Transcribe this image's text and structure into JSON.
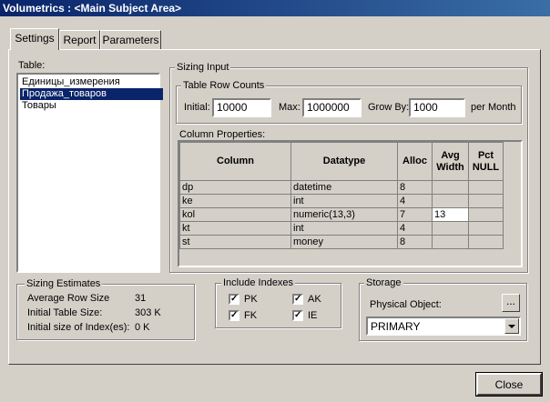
{
  "window": {
    "title": "Volumetrics : <Main Subject Area>"
  },
  "tabs": [
    {
      "label": "Settings",
      "active": true
    },
    {
      "label": "Report",
      "active": false
    },
    {
      "label": "Parameters",
      "active": false
    }
  ],
  "table_list": {
    "label": "Table:",
    "items": [
      {
        "label": "Единицы_измерения",
        "selected": false
      },
      {
        "label": "Продажа_товаров",
        "selected": true
      },
      {
        "label": "Товары",
        "selected": false
      }
    ]
  },
  "sizing_input": {
    "title": "Sizing Input",
    "row_counts": {
      "title": "Table Row Counts",
      "initial_label": "Initial:",
      "initial_value": "10000",
      "max_label": "Max:",
      "max_value": "1000000",
      "grow_label": "Grow By:",
      "grow_value": "1000",
      "per_label": "per Month"
    },
    "column_properties": {
      "title": "Column Properties:",
      "headers": {
        "column": "Column",
        "datatype": "Datatype",
        "alloc": "Alloc",
        "avg_width": "Avg Width",
        "pct_null": "Pct NULL"
      },
      "rows": [
        {
          "column": "dp",
          "datatype": "datetime",
          "alloc": "8",
          "avg_width": "",
          "pct_null": ""
        },
        {
          "column": "ke",
          "datatype": "int",
          "alloc": "4",
          "avg_width": "",
          "pct_null": ""
        },
        {
          "column": "kol",
          "datatype": "numeric(13,3)",
          "alloc": "7",
          "avg_width": "13",
          "pct_null": ""
        },
        {
          "column": "kt",
          "datatype": "int",
          "alloc": "4",
          "avg_width": "",
          "pct_null": ""
        },
        {
          "column": "st",
          "datatype": "money",
          "alloc": "8",
          "avg_width": "",
          "pct_null": ""
        }
      ]
    }
  },
  "sizing_estimates": {
    "title": "Sizing Estimates",
    "avg_row_label": "Average Row Size",
    "avg_row_value": "31",
    "initial_size_label": "Initial Table Size:",
    "initial_size_value": "303 K",
    "index_size_label": "Initial size of Index(es):",
    "index_size_value": "0 K"
  },
  "include_indexes": {
    "title": "Include Indexes",
    "pk": {
      "label": "PK",
      "checked": true
    },
    "ak": {
      "label": "AK",
      "checked": true
    },
    "fk": {
      "label": "FK",
      "checked": true
    },
    "ie": {
      "label": "IE",
      "checked": true
    }
  },
  "storage": {
    "title": "Storage",
    "physical_label": "Physical Object:",
    "browse_label": "...",
    "selected": "PRIMARY"
  },
  "close_label": "Close",
  "icons": {
    "check": "checkmark-icon",
    "dropdown": "chevron-down-icon",
    "close": "close-icon"
  }
}
